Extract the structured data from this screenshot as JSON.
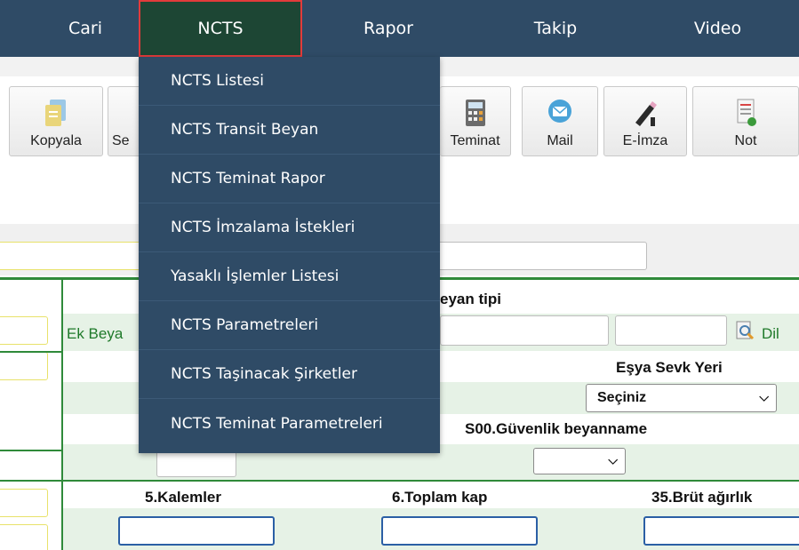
{
  "nav": {
    "items": [
      {
        "label": "Cari"
      },
      {
        "label": "NCTS"
      },
      {
        "label": "Rapor"
      },
      {
        "label": "Takip"
      },
      {
        "label": "Video"
      }
    ],
    "active": "NCTS"
  },
  "toolbar": {
    "buttons": [
      {
        "label": "Kopyala",
        "icon": "copy-icon"
      },
      {
        "label": "Se",
        "icon": "document-icon"
      },
      {
        "label": "Teminat",
        "icon": "calculator-icon"
      },
      {
        "label": "Mail",
        "icon": "mail-icon"
      },
      {
        "label": "E-İmza",
        "icon": "pen-icon"
      },
      {
        "label": "Not",
        "icon": "note-icon"
      }
    ]
  },
  "dropdown": {
    "items": [
      {
        "label": "NCTS Listesi"
      },
      {
        "label": "NCTS Transit Beyan"
      },
      {
        "label": "NCTS Teminat Rapor"
      },
      {
        "label": "NCTS İmzalama İstekleri"
      },
      {
        "label": "Yasaklı İşlemler Listesi"
      },
      {
        "label": "NCTS Parametreleri"
      },
      {
        "label": "NCTS Taşinacak Şirketler"
      },
      {
        "label": "NCTS Teminat Parametreleri"
      }
    ]
  },
  "form": {
    "beyan_tipi": "eyan tipi",
    "ek_beyan": "Ek Beya",
    "dil": "Dil",
    "esya_sevk_yeri": "Eşya Sevk Yeri",
    "esya_sevk_select": "Seçiniz",
    "guvenlik_beyanname": "S00.Güvenlik beyanname",
    "kalemler": "5.Kalemler",
    "toplam_kap": "6.Toplam kap",
    "brut_agirlik": "35.Brüt ağırlık"
  },
  "colors": {
    "nav_bg": "#2f4b66",
    "nav_active_bg": "#1d4634",
    "nav_active_border": "#e23b3b",
    "form_green": "#2f8a3a",
    "input_blue": "#2b5fa5",
    "input_yellow": "#e8e26a"
  }
}
